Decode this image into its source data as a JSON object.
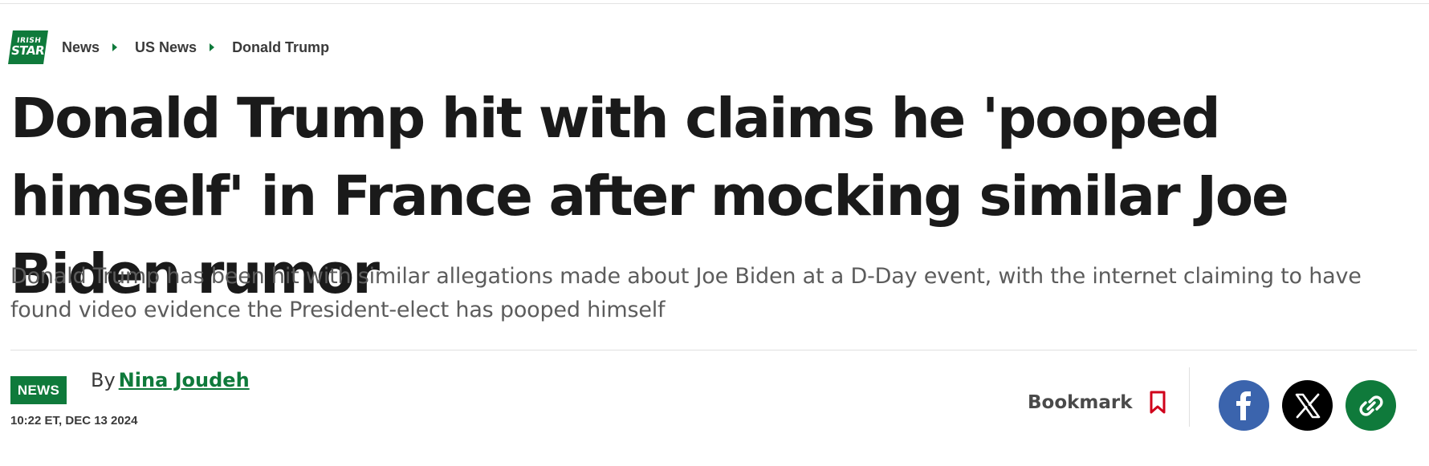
{
  "brand": {
    "logo_line1": "IRISH",
    "logo_line2": "STAR",
    "accent": "#0f7a3b"
  },
  "breadcrumb": {
    "items": [
      "News",
      "US News",
      "Donald Trump"
    ]
  },
  "article": {
    "headline": "Donald Trump hit with claims he 'pooped himself' in France after mocking similar Joe Biden rumor",
    "standfirst": "Donald Trump has been hit with similar allegations made about Joe Biden at a D-Day event, with the internet claiming to have found video evidence the President-elect has pooped himself",
    "badge": "NEWS",
    "by_prefix": "By",
    "author": "Nina Joudeh",
    "timestamp": "10:22 ET, DEC 13 2024"
  },
  "actions": {
    "bookmark_label": "Bookmark",
    "bookmark_color": "#d0021b",
    "share": [
      {
        "icon": "facebook-icon",
        "color": "#3b64ad"
      },
      {
        "icon": "x-icon",
        "color": "#000000"
      },
      {
        "icon": "link-icon",
        "color": "#0f7a3b"
      }
    ]
  }
}
